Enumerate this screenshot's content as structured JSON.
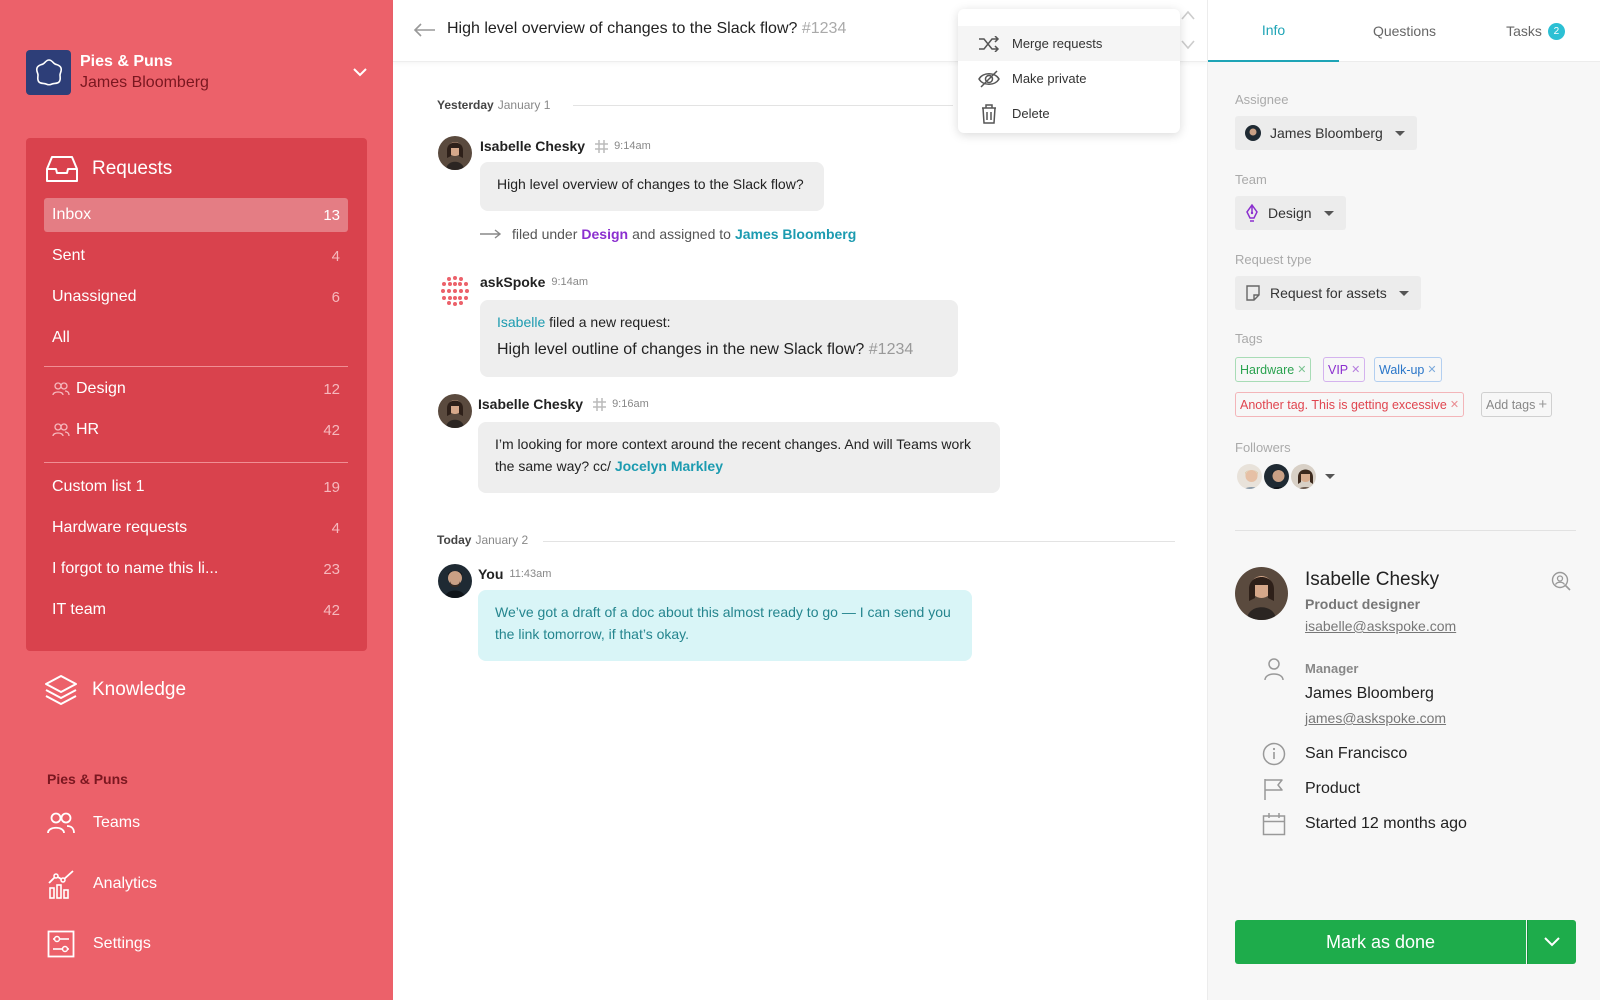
{
  "workspace": {
    "name": "Pies & Puns",
    "user": "James Bloomberg"
  },
  "sidebar": {
    "requests_label": "Requests",
    "items": [
      {
        "label": "Inbox",
        "count": "13"
      },
      {
        "label": "Sent",
        "count": "4"
      },
      {
        "label": "Unassigned",
        "count": "6"
      },
      {
        "label": "All",
        "count": ""
      },
      {
        "label": "Design",
        "count": "12"
      },
      {
        "label": "HR",
        "count": "42"
      },
      {
        "label": "Custom list 1",
        "count": "19"
      },
      {
        "label": "Hardware requests",
        "count": "4"
      },
      {
        "label": "I forgot to name this li...",
        "count": "23"
      },
      {
        "label": "IT team",
        "count": "42"
      }
    ],
    "knowledge_label": "Knowledge",
    "section_title": "Pies & Puns",
    "bottom": [
      {
        "label": "Teams"
      },
      {
        "label": "Analytics"
      },
      {
        "label": "Settings"
      }
    ]
  },
  "conversation": {
    "title": "High level overview of changes to the Slack flow?",
    "number": "#1234",
    "day1": {
      "bold": "Yesterday",
      "date": "January 1"
    },
    "day2": {
      "bold": "Today",
      "date": "January 2"
    },
    "messages": [
      {
        "author": "Isabelle Chesky",
        "time": "9:14am",
        "text": "High level overview of changes to the Slack flow?"
      },
      {
        "author": "askSpoke",
        "time": "9:14am",
        "mention": "Isabelle",
        "text1": "filed a new request:",
        "title": "High level outline of changes in the new Slack flow?",
        "number": "#1234"
      },
      {
        "author": "Isabelle Chesky",
        "time": "9:16am",
        "text": "I’m looking for more context around the recent changes. And will Teams work the same way? cc/",
        "mention": "Jocelyn Markley"
      },
      {
        "author": "You",
        "time": "11:43am",
        "text": "We’ve got a draft of a doc about this almost ready to go — I can send you the link tomorrow, if that’s okay."
      }
    ],
    "filed": {
      "prefix": "filed under",
      "team": "Design",
      "middle": "and assigned to",
      "person": "James Bloomberg"
    }
  },
  "dropdown": {
    "items": [
      {
        "label": "Merge requests"
      },
      {
        "label": "Make private"
      },
      {
        "label": "Delete"
      }
    ]
  },
  "panel": {
    "tabs": [
      {
        "label": "Info"
      },
      {
        "label": "Questions"
      },
      {
        "label": "Tasks",
        "badge": "2"
      }
    ],
    "assignee_label": "Assignee",
    "assignee": "James Bloomberg",
    "team_label": "Team",
    "team": "Design",
    "request_type_label": "Request type",
    "request_type": "Request for assets",
    "tags_label": "Tags",
    "tags": [
      {
        "label": "Hardware",
        "color": "#2aa24f"
      },
      {
        "label": "VIP",
        "color": "#8b2fcf"
      },
      {
        "label": "Walk-up",
        "color": "#2a76c9"
      },
      {
        "label": "Another tag. This is getting excessive",
        "color": "#e0454f"
      }
    ],
    "add_tags": "Add tags",
    "followers_label": "Followers",
    "profile": {
      "name": "Isabelle Chesky",
      "role": "Product designer",
      "email": "isabelle@askspoke.com",
      "manager_label": "Manager",
      "manager": "James Bloomberg",
      "manager_email": "james@askspoke.com",
      "location": "San Francisco",
      "department": "Product",
      "started": "Started 12 months ago"
    },
    "done_label": "Mark as done"
  },
  "colors": {
    "sidebar": "#ec616a",
    "sidebar_box": "#d9424d",
    "accent": "#1ea4b6",
    "done": "#1eac4b"
  }
}
